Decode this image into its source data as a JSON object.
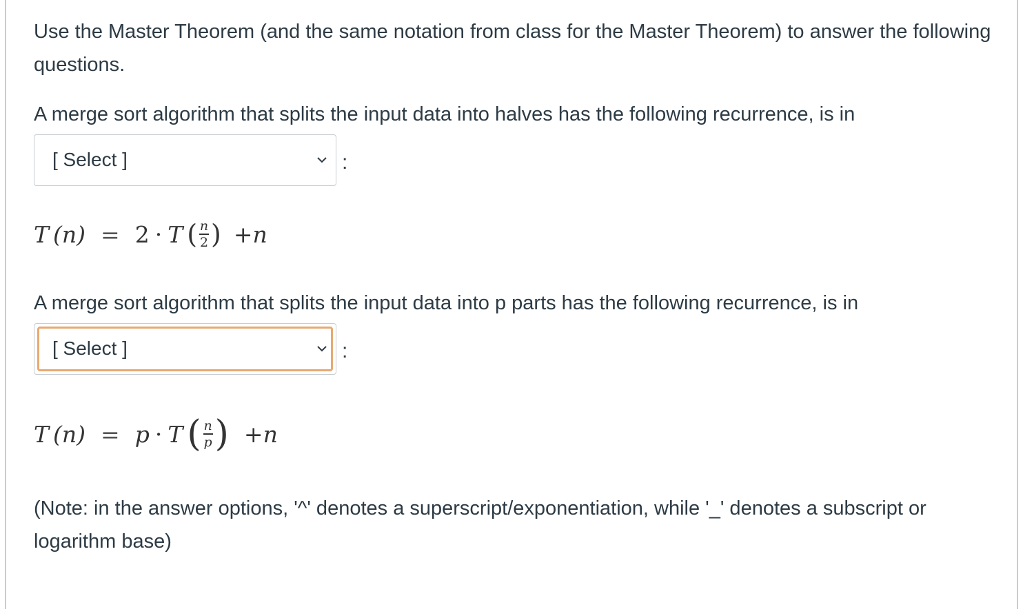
{
  "intro_text": "Use the Master Theorem (and the same notation from class for the Master Theorem) to answer the following questions.",
  "questions": [
    {
      "prompt": "A merge sort algorithm that splits the input data into halves has the following recurrence, is in",
      "select": {
        "selected": "[ Select ]"
      },
      "colon": ":",
      "formula": {
        "lhs": "T",
        "lhs_arg": "(n)",
        "eq": "=",
        "coef": "2",
        "dot": "·",
        "func": "T",
        "frac_num": "n",
        "frac_den": "2",
        "plus": "+",
        "tail": "n"
      }
    },
    {
      "prompt": "A merge sort algorithm that splits the input data into p parts has the following recurrence, is in",
      "select": {
        "selected": "[ Select ]",
        "focused": true
      },
      "colon": ":",
      "formula": {
        "lhs": "T",
        "lhs_arg": "(n)",
        "eq": "=",
        "coef": "p",
        "dot": "·",
        "func": "T",
        "frac_num": "n",
        "frac_den": "p",
        "plus": "+",
        "tail": "n"
      }
    }
  ],
  "note_text": "(Note: in the answer options, '^' denotes a superscript/exponentiation, while '_' denotes a subscript or logarithm base)",
  "colors": {
    "text": "#2d3b45",
    "border": "#c7cdd1",
    "focus_ring": "#e8a970"
  },
  "icons": {
    "dropdown": "chevron-down-icon"
  }
}
